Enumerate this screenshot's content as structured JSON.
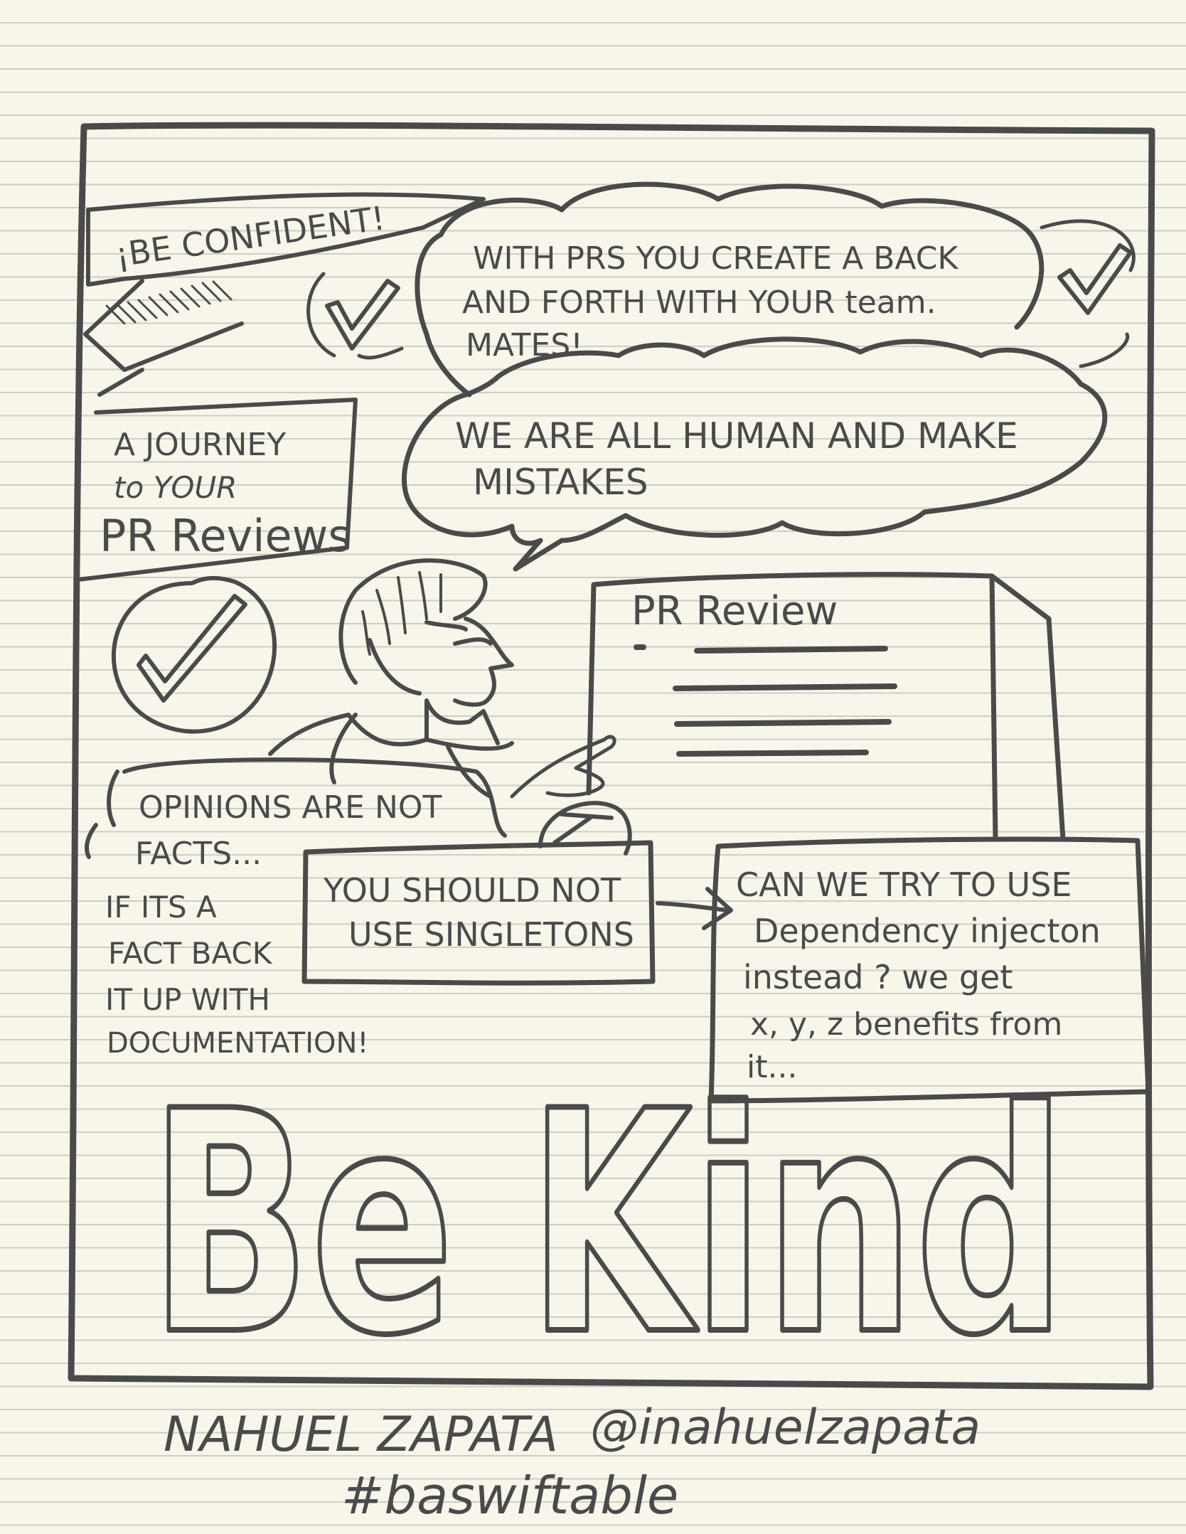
{
  "banner": {
    "text": "¡BE CONFIDENT!"
  },
  "title_box": {
    "line1": "A JOURNEY",
    "line2": "to YOUR",
    "line3": "PR Reviews"
  },
  "bubble_top": {
    "line1": "WITH PRS YOU CREATE A BACK",
    "line2": "AND FORTH WITH YOUR team.",
    "line3": "MATES!"
  },
  "bubble_mid": {
    "line1": "WE ARE ALL HUMAN AND MAKE",
    "line2": "MISTAKES"
  },
  "screen": {
    "title": "PR Review"
  },
  "opinions": {
    "line1": "OPINIONS ARE NOT",
    "line2": "FACTS..."
  },
  "fact_note": {
    "line1": "IF ITS A",
    "line2": "FACT BACK",
    "line3": "IT UP WITH",
    "line4": "DOCUMENTATION!"
  },
  "bad_comment": {
    "line1": "YOU SHOULD NOT",
    "line2": "USE SINGLETONS"
  },
  "good_comment": {
    "line1": "CAN WE TRY TO USE",
    "line2": "Dependency injecton",
    "line3": "instead ? we get",
    "line4": "x, y, z benefits from",
    "line5": "it..."
  },
  "headline": {
    "text": "Be Kind"
  },
  "footer": {
    "author": "NAHUEL ZAPATA",
    "handle": "@inahuelzapata",
    "hashtag": "#baswiftable"
  },
  "colors": {
    "paper": "#f8f6ea",
    "rule": "#cfcdc4",
    "ink": "#4a4a4a"
  },
  "icons": [
    "checkmark-icon",
    "checkmark-in-circle-icon",
    "person-illustration",
    "arrow-right-icon"
  ]
}
